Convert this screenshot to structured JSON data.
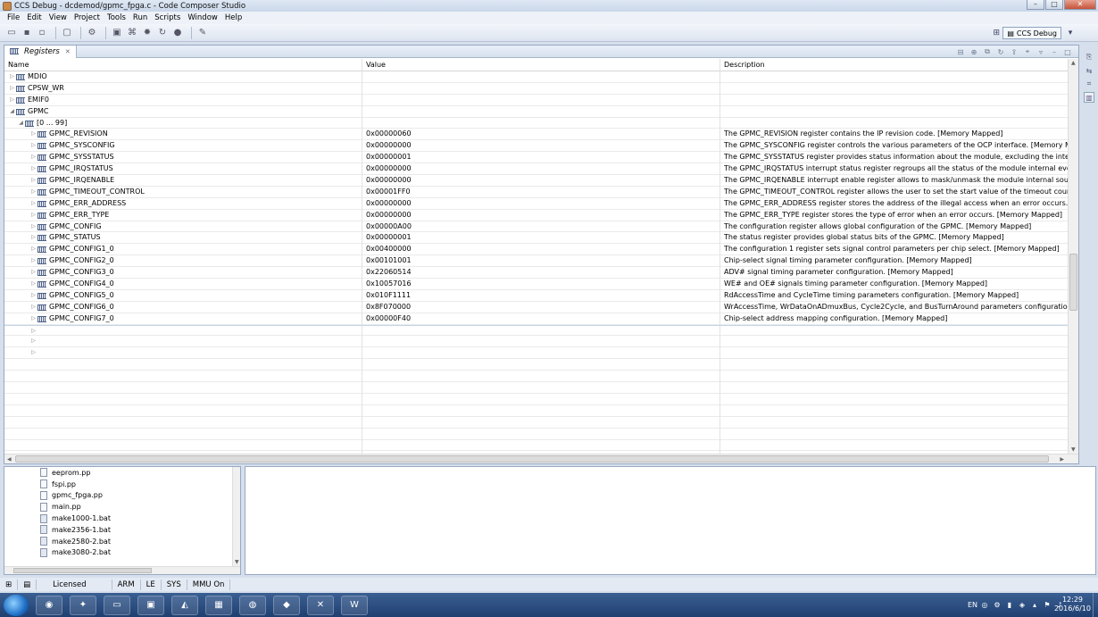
{
  "window": {
    "title": "CCS Debug - dcdemod/gpmc_fpga.c - Code Composer Studio"
  },
  "menu": [
    "File",
    "Edit",
    "View",
    "Project",
    "Tools",
    "Run",
    "Scripts",
    "Window",
    "Help"
  ],
  "perspective": {
    "label": "CCS Debug"
  },
  "registers_view": {
    "tab_label": "Registers",
    "columns": {
      "name": "Name",
      "value": "Value",
      "description": "Description"
    },
    "groups": [
      {
        "label": "MDIO"
      },
      {
        "label": "CPSW_WR"
      },
      {
        "label": "EMIF0"
      },
      {
        "label": "GPMC"
      }
    ],
    "range_label": "[0 ... 99]",
    "rows": [
      {
        "name": "GPMC_REVISION",
        "value": "0x00000060",
        "desc": "The GPMC_REVISION register contains the IP revision code. [Memory Mapped]"
      },
      {
        "name": "GPMC_SYSCONFIG",
        "value": "0x00000000",
        "desc": "The GPMC_SYSCONFIG register controls the various parameters of the OCP interface. [Memory Mapped"
      },
      {
        "name": "GPMC_SYSSTATUS",
        "value": "0x00000001",
        "desc": "The GPMC_SYSSTATUS register provides status information about the module, excluding the interrupt st"
      },
      {
        "name": "GPMC_IRQSTATUS",
        "value": "0x00000000",
        "desc": "The GPMC_IRQSTATUS interrupt status register regroups all the status of the module internal events tha"
      },
      {
        "name": "GPMC_IRQENABLE",
        "value": "0x00000000",
        "desc": "The GPMC_IRQENABLE interrupt enable register allows to mask/unmask the module internal sources of"
      },
      {
        "name": "GPMC_TIMEOUT_CONTROL",
        "value": "0x00001FF0",
        "desc": "The GPMC_TIMEOUT_CONTROL register allows the user to set the start value of the timeout counter [M"
      },
      {
        "name": "GPMC_ERR_ADDRESS",
        "value": "0x00000000",
        "desc": "The GPMC_ERR_ADDRESS register stores the address of the illegal access when an error occurs. [Memo"
      },
      {
        "name": "GPMC_ERR_TYPE",
        "value": "0x00000000",
        "desc": "The GPMC_ERR_TYPE register stores the type of error when an error occurs. [Memory Mapped]"
      },
      {
        "name": "GPMC_CONFIG",
        "value": "0x00000A00",
        "desc": "The configuration register allows global configuration of the GPMC. [Memory Mapped]"
      },
      {
        "name": "GPMC_STATUS",
        "value": "0x00000001",
        "desc": "The status register provides global status bits of the GPMC. [Memory Mapped]"
      },
      {
        "name": "GPMC_CONFIG1_0",
        "value": "0x00400000",
        "desc": "The configuration 1 register sets signal control parameters per chip select. [Memory Mapped]"
      },
      {
        "name": "GPMC_CONFIG2_0",
        "value": "0x00101001",
        "desc": "Chip-select signal timing parameter configuration. [Memory Mapped]"
      },
      {
        "name": "GPMC_CONFIG3_0",
        "value": "0x22060514",
        "desc": "ADV# signal timing parameter configuration. [Memory Mapped]"
      },
      {
        "name": "GPMC_CONFIG4_0",
        "value": "0x10057016",
        "desc": "WE# and OE# signals timing parameter configuration. [Memory Mapped]"
      },
      {
        "name": "GPMC_CONFIG5_0",
        "value": "0x010F1111",
        "desc": "RdAccessTime and CycleTime timing parameters configuration. [Memory Mapped]"
      },
      {
        "name": "GPMC_CONFIG6_0",
        "value": "0x8F070000",
        "desc": "WrAccessTime, WrDataOnADmuxBus, Cycle2Cycle, and BusTurnAround parameters configuration [Memo"
      },
      {
        "name": "GPMC_CONFIG7_0",
        "value": "0x00000F40",
        "desc": "Chip-select address mapping configuration. [Memory Mapped]"
      }
    ]
  },
  "files": [
    "eeprom.pp",
    "fspi.pp",
    "gpmc_fpga.pp",
    "main.pp",
    "make1000-1.bat",
    "make2356-1.bat",
    "make2580-2.bat",
    "make3080-2.bat"
  ],
  "status": [
    "Licensed",
    "ARM",
    "LE",
    "SYS",
    "MMU On"
  ],
  "tray": {
    "lang": "EN",
    "time": "12:29",
    "date": "2016/6/10"
  }
}
